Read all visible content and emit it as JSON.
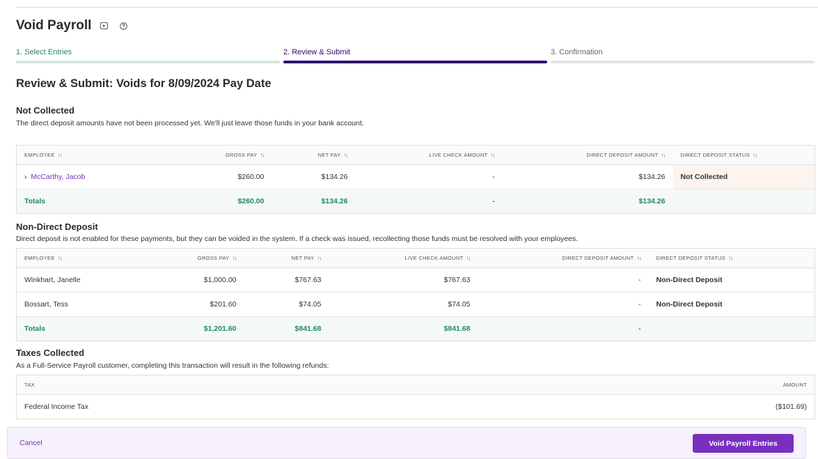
{
  "page": {
    "title": "Void Payroll"
  },
  "steps": [
    {
      "label": "1. Select Entries",
      "state": "done"
    },
    {
      "label": "2. Review & Submit",
      "state": "active"
    },
    {
      "label": "3. Confirmation",
      "state": "pending"
    }
  ],
  "colors": {
    "accent": "#7b2fbf",
    "active_step": "#2d0a6e",
    "done_step": "#d3e5df",
    "pending_step": "#e4e4e4",
    "done_label": "#2e7d6b",
    "active_label": "#2d0a6e",
    "pending_label": "#666666",
    "totals": "#1f8a5a"
  },
  "review": {
    "heading": "Review & Submit: Voids for 8/09/2024 Pay Date"
  },
  "not_collected": {
    "title": "Not Collected",
    "description": "The direct deposit amounts have not been processed yet. We'll just leave those funds in your bank account.",
    "headers": {
      "employee": "Employee",
      "gross": "Gross Pay",
      "net": "Net Pay",
      "live": "Live Check Amount",
      "dd": "Direct Deposit Amount",
      "status": "Direct Deposit Status"
    },
    "rows": [
      {
        "employee": "McCarthy, Jacob",
        "gross": "$260.00",
        "net": "$134.26",
        "live": "-",
        "dd": "$134.26",
        "status": "Not Collected"
      }
    ],
    "totals": {
      "label": "Totals",
      "gross": "$260.00",
      "net": "$134.26",
      "live": "-",
      "dd": "$134.26"
    }
  },
  "non_dd": {
    "title": "Non-Direct Deposit",
    "description": "Direct deposit is not enabled for these payments, but they can be voided in the system. If a check was issued, recollecting those funds must be resolved with your employees.",
    "headers": {
      "employee": "Employee",
      "gross": "Gross Pay",
      "net": "Net Pay",
      "live": "Live Check Amount",
      "dd": "Direct Deposit Amount",
      "status": "Direct Deposit Status"
    },
    "rows": [
      {
        "employee": "Winkhart, Janelle",
        "gross": "$1,000.00",
        "net": "$767.63",
        "live": "$767.63",
        "dd": "-",
        "status": "Non-Direct Deposit"
      },
      {
        "employee": "Bossart, Tess",
        "gross": "$201.60",
        "net": "$74.05",
        "live": "$74.05",
        "dd": "-",
        "status": "Non-Direct Deposit"
      }
    ],
    "totals": {
      "label": "Totals",
      "gross": "$1,201.60",
      "net": "$841.68",
      "live": "$841.68",
      "dd": "-"
    }
  },
  "taxes": {
    "title": "Taxes Collected",
    "description": "As a Full-Service Payroll customer, completing this transaction will result in the following refunds:",
    "headers": {
      "tax": "Tax",
      "amount": "Amount"
    },
    "rows": [
      {
        "tax": "Federal Income Tax",
        "amount": "($101.69)"
      }
    ]
  },
  "footer": {
    "cancel": "Cancel",
    "submit": "Void Payroll Entries"
  }
}
